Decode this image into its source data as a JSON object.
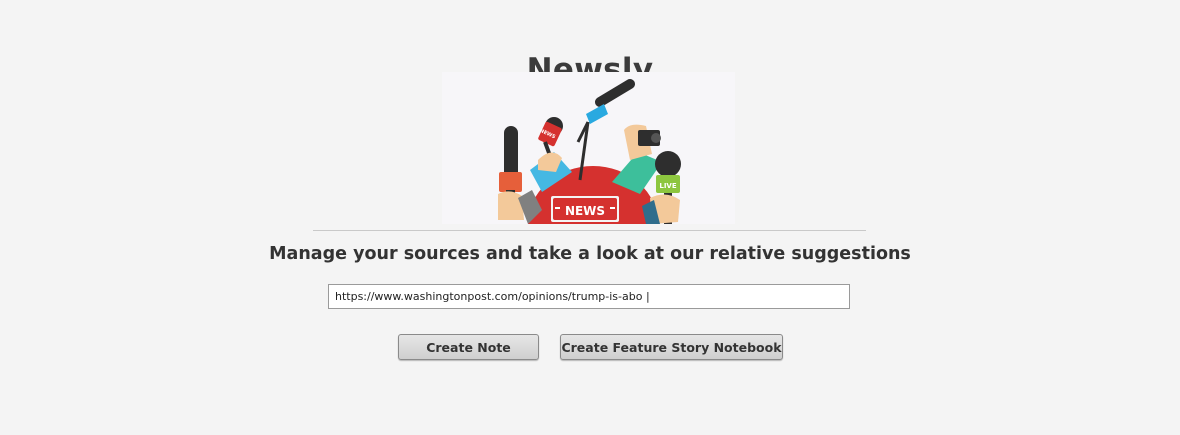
{
  "app": {
    "title": "Newsly",
    "tagline": "Manage your sources and take a look at our relative suggestions"
  },
  "hero": {
    "podium_text": "NEWS",
    "mic_flag_text": "NEWS",
    "live_badge_text": "LIVE"
  },
  "source_input": {
    "value": "https://www.washingtonpost.com/opinions/trump-is-abo |"
  },
  "actions": {
    "create_note_label": "Create Note",
    "create_feature_label": "Create Feature Story Notebook"
  },
  "colors": {
    "podium_red": "#d5312f",
    "live_green": "#8dc63f",
    "mic_blue": "#29a9e0",
    "sleeve_teal": "#3dbf9b",
    "sleeve_cyan": "#45b8e3",
    "mic_orange": "#e65f3a"
  }
}
